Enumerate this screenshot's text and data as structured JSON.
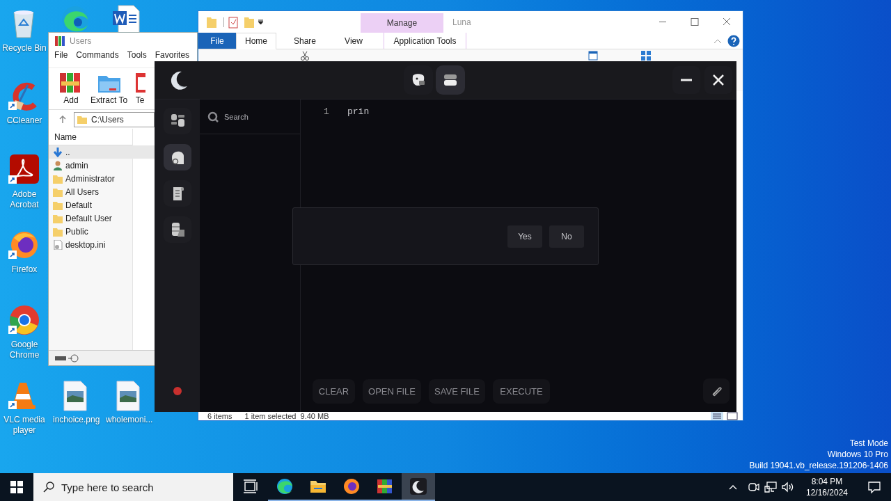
{
  "desktop_icons": [
    {
      "kind": "recycle",
      "label": "Recycle Bin"
    },
    {
      "kind": "edge"
    },
    {
      "kind": "word"
    },
    {
      "kind": "ccleaner",
      "label": "CCleaner"
    },
    {
      "kind": "acrobat",
      "label": "Adobe Acrobat"
    },
    {
      "kind": "firefox",
      "label": "Firefox"
    },
    {
      "kind": "chrome",
      "label": "Google Chrome"
    },
    {
      "kind": "vlc",
      "label": "VLC media player"
    },
    {
      "kind": "image",
      "label": "inchoice.png"
    },
    {
      "kind": "image",
      "label": "wholemoni..."
    }
  ],
  "winrar": {
    "title": "Users",
    "menu": [
      "File",
      "Commands",
      "Tools",
      "Favorites"
    ],
    "toolbar": [
      {
        "kind": "add",
        "label": "Add"
      },
      {
        "kind": "extract",
        "label": "Extract To"
      },
      {
        "kind": "test",
        "label": "Te"
      }
    ],
    "address": "C:\\Users",
    "column": "Name",
    "files": [
      {
        "kind": "up",
        "name": "..",
        "selected": true
      },
      {
        "kind": "user",
        "name": "admin",
        "selected": false
      },
      {
        "kind": "folder",
        "name": "Administrator",
        "selected": false
      },
      {
        "kind": "folder",
        "name": "All Users",
        "selected": false
      },
      {
        "kind": "folder",
        "name": "Default",
        "selected": false
      },
      {
        "kind": "folder",
        "name": "Default User",
        "selected": false
      },
      {
        "kind": "folder",
        "name": "Public",
        "selected": false
      },
      {
        "kind": "ini",
        "name": "desktop.ini",
        "selected": false
      }
    ]
  },
  "explorer": {
    "context_tab": "Manage",
    "title": "Luna",
    "tabs": [
      {
        "kind": "file",
        "label": "File",
        "selected": false
      },
      {
        "kind": "plain",
        "label": "Home",
        "selected": true
      },
      {
        "kind": "plain",
        "label": "Share",
        "selected": false
      },
      {
        "kind": "plain",
        "label": "View",
        "selected": false
      },
      {
        "kind": "context",
        "label": "Application Tools",
        "selected": false
      }
    ],
    "ribbon": [
      {
        "kind": "cut"
      },
      {
        "kind": "open"
      },
      {
        "kind": "selectall"
      }
    ],
    "status": [
      "6 items",
      "1 item selected  9.40 MB"
    ]
  },
  "luna": {
    "top_buttons": [
      {
        "kind": "chat",
        "selected": false
      },
      {
        "kind": "drawer",
        "selected": true
      }
    ],
    "rail": [
      {
        "kind": "grid",
        "selected": false
      },
      {
        "kind": "head",
        "selected": true
      },
      {
        "kind": "scroll",
        "selected": false
      },
      {
        "kind": "stack",
        "selected": false
      }
    ],
    "search": {
      "placeholder": "Search"
    },
    "editor": [
      {
        "number": "1",
        "code": "prin"
      }
    ],
    "dialog": {
      "buttons": [
        "Yes",
        "No"
      ]
    },
    "actions": [
      "CLEAR",
      "OPEN FILE",
      "SAVE FILE",
      "EXECUTE"
    ]
  },
  "taskbar": {
    "search": {
      "placeholder": "Type here to search"
    },
    "apps": [
      {
        "kind": "taskview",
        "running": false,
        "selected": false
      },
      {
        "kind": "edge",
        "running": true,
        "selected": false
      },
      {
        "kind": "folder",
        "running": true,
        "selected": false
      },
      {
        "kind": "firefox",
        "running": true,
        "selected": false
      },
      {
        "kind": "winrar",
        "running": true,
        "selected": false
      },
      {
        "kind": "luna",
        "running": true,
        "selected": true
      }
    ],
    "time": "8:04 PM",
    "date": "12/16/2024"
  },
  "system_notice": [
    "Test Mode",
    "Windows 10 Pro",
    "Build 19041.vb_release.191206-1406"
  ]
}
